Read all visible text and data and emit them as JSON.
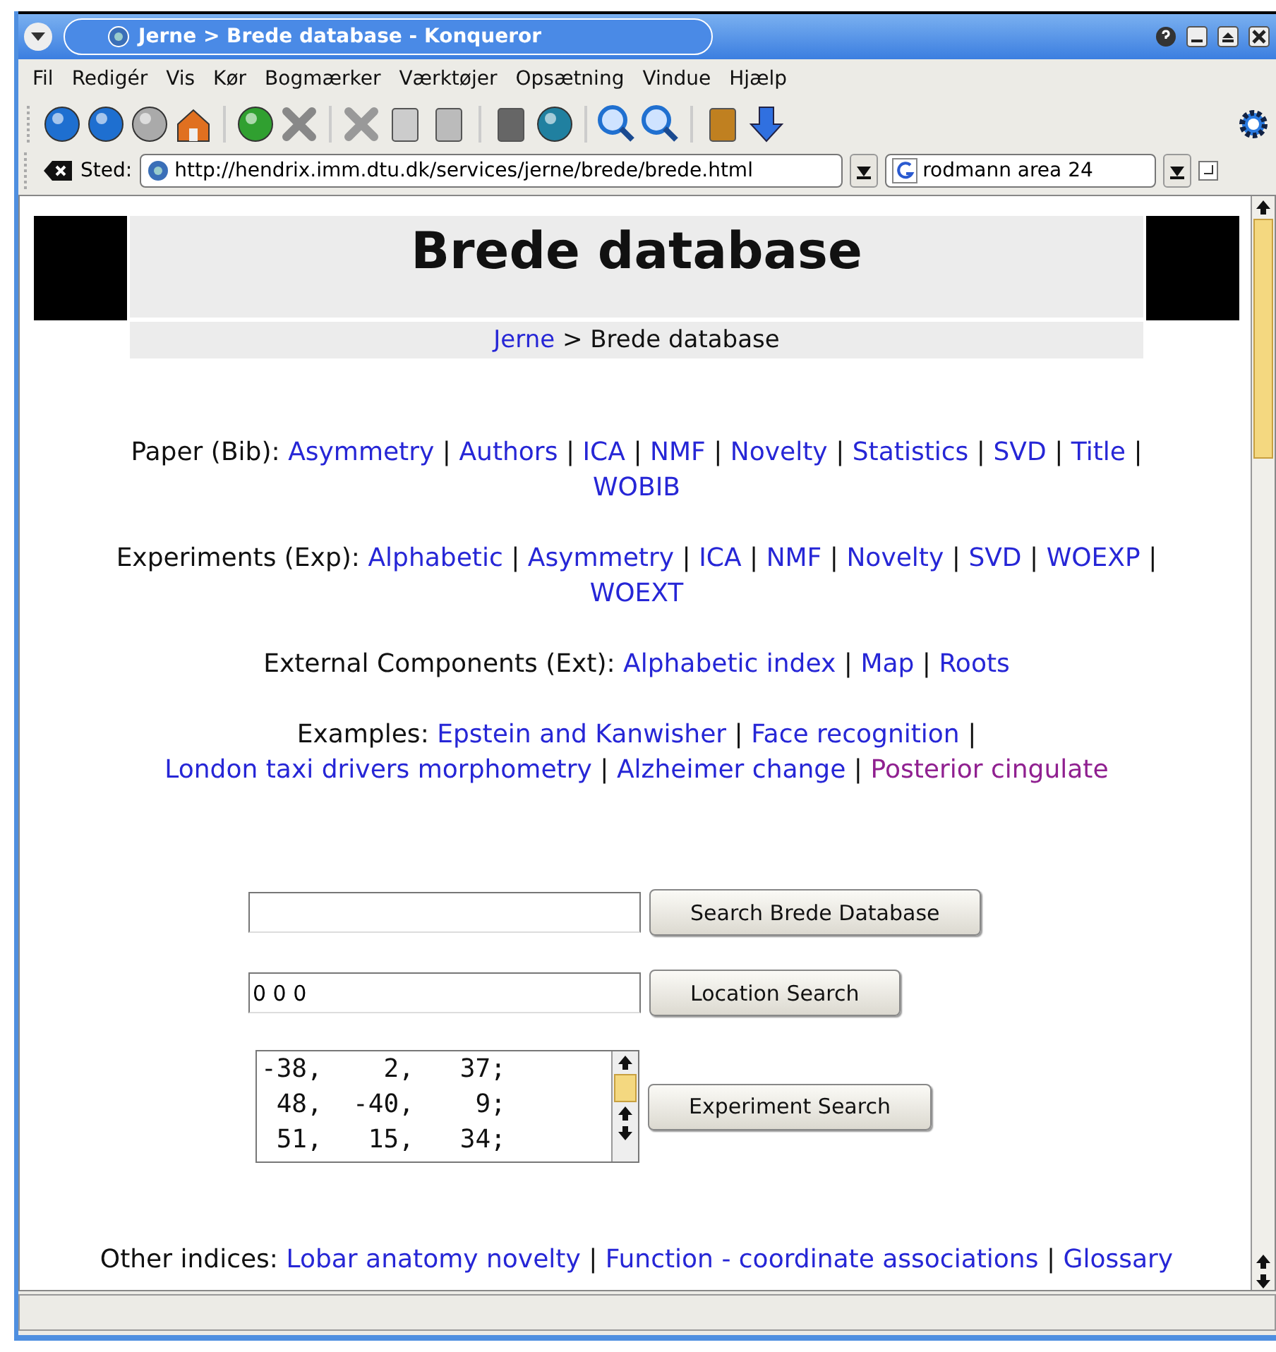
{
  "window": {
    "title": "Jerne > Brede database - Konqueror"
  },
  "menu": [
    "Fil",
    "Redigér",
    "Vis",
    "Kør",
    "Bogmærker",
    "Værktøjer",
    "Opsætning",
    "Vindue",
    "Hjælp"
  ],
  "location": {
    "label": "Sted:",
    "url": "http://hendrix.imm.dtu.dk/services/jerne/brede/brede.html",
    "search_value": "rodmann area 24"
  },
  "page": {
    "heading": "Brede database",
    "breadcrumb": {
      "link": "Jerne",
      "current": "> Brede database"
    },
    "sections": [
      {
        "label": "Paper (Bib):",
        "separator": "|",
        "links": [
          {
            "text": "Asymmetry",
            "visited": false
          },
          {
            "text": "Authors",
            "visited": false
          },
          {
            "text": "ICA",
            "visited": false
          },
          {
            "text": "NMF",
            "visited": false
          },
          {
            "text": "Novelty",
            "visited": false
          },
          {
            "text": "Statistics",
            "visited": false
          },
          {
            "text": "SVD",
            "visited": false
          },
          {
            "text": "Title",
            "visited": false
          },
          {
            "text": "WOBIB",
            "visited": false
          }
        ]
      },
      {
        "label": "Experiments (Exp):",
        "separator": "|",
        "links": [
          {
            "text": "Alphabetic",
            "visited": false
          },
          {
            "text": "Asymmetry",
            "visited": false
          },
          {
            "text": "ICA",
            "visited": false
          },
          {
            "text": "NMF",
            "visited": false
          },
          {
            "text": "Novelty",
            "visited": false
          },
          {
            "text": "SVD",
            "visited": false
          },
          {
            "text": "WOEXP",
            "visited": false
          },
          {
            "text": "WOEXT",
            "visited": false
          }
        ]
      },
      {
        "label": "External Components (Ext):",
        "separator": "|",
        "links": [
          {
            "text": "Alphabetic index",
            "visited": false
          },
          {
            "text": "Map",
            "visited": false
          },
          {
            "text": "Roots",
            "visited": false
          }
        ]
      },
      {
        "label": "Examples:",
        "separator": "|",
        "links": [
          {
            "text": "Epstein and Kanwisher",
            "visited": false
          },
          {
            "text": "Face recognition",
            "visited": false
          },
          {
            "text": "London taxi drivers morphometry",
            "visited": false
          },
          {
            "text": "Alzheimer change",
            "visited": false
          },
          {
            "text": "Posterior cingulate",
            "visited": true
          }
        ]
      }
    ],
    "forms": [
      {
        "kind": "input",
        "button": "Search Brede Database"
      },
      {
        "kind": "input",
        "value": "0 0 0",
        "button": "Location Search"
      },
      {
        "kind": "textarea",
        "lines": [
          "-38,    2,   37;",
          " 48,  -40,    9;",
          " 51,   15,   34;"
        ],
        "button": "Experiment Search"
      }
    ],
    "other": {
      "label": "Other indices:",
      "separator": "|",
      "links": [
        {
          "text": "Lobar anatomy novelty",
          "visited": false
        },
        {
          "text": "Function - coordinate associations",
          "visited": false
        },
        {
          "text": "Glossary",
          "visited": false
        }
      ]
    }
  }
}
